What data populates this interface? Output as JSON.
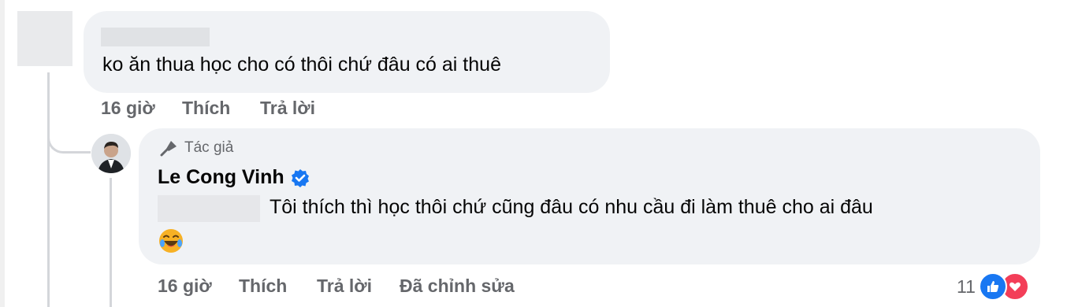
{
  "comment_1": {
    "text": "ko ăn thua học cho có thôi chứ đâu có ai thuê",
    "time": "16 giờ",
    "like_label": "Thích",
    "reply_label": "Trả lời"
  },
  "comment_2": {
    "author_badge": "Tác giả",
    "author_name": "Le Cong Vinh",
    "text": "Tôi thích thì học thôi chứ cũng đâu có nhu cầu đi làm thuê cho ai đâu",
    "time": "16 giờ",
    "like_label": "Thích",
    "reply_label": "Trả lời",
    "edited_label": "Đã chỉnh sửa",
    "reaction_count": "11",
    "reactions": [
      "like-icon",
      "love-icon"
    ],
    "emoji": "laughing-emoji"
  },
  "colors": {
    "bubble": "#f0f2f5",
    "meta_text": "#65676b",
    "verified": "#1877f2",
    "like": "#1877f2",
    "love": "#f33e58",
    "haha": "#f7b125"
  }
}
